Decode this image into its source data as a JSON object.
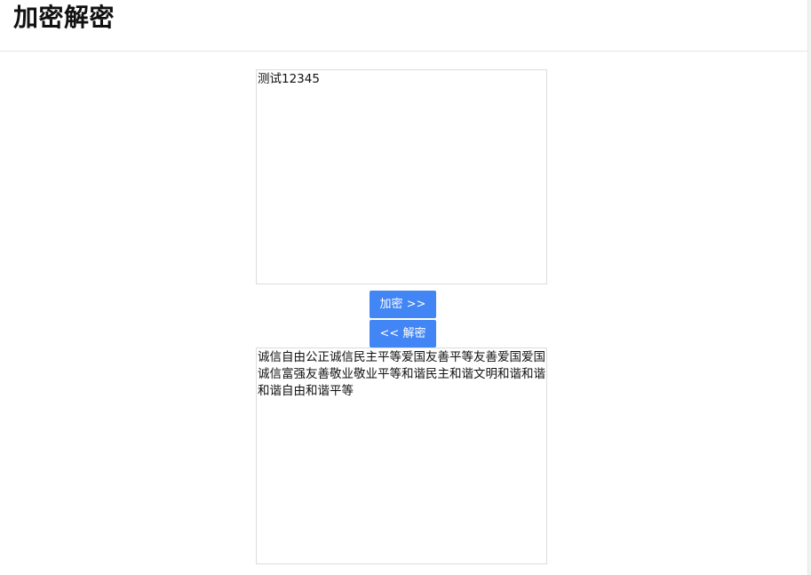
{
  "header": {
    "title": "加密解密"
  },
  "plaintext": {
    "value": "测试12345"
  },
  "actions": {
    "encrypt_label": "加密 >>",
    "decrypt_label": "<< 解密"
  },
  "ciphertext": {
    "value": "诚信自由公正诚信民主平等爱国友善平等友善爱国爱国诚信富强友善敬业敬业平等和谐民主和谐文明和谐和谐和谐自由和谐平等"
  },
  "colors": {
    "button_bg": "#4285f4",
    "button_text": "#ffffff",
    "border": "#dcdcdc"
  }
}
